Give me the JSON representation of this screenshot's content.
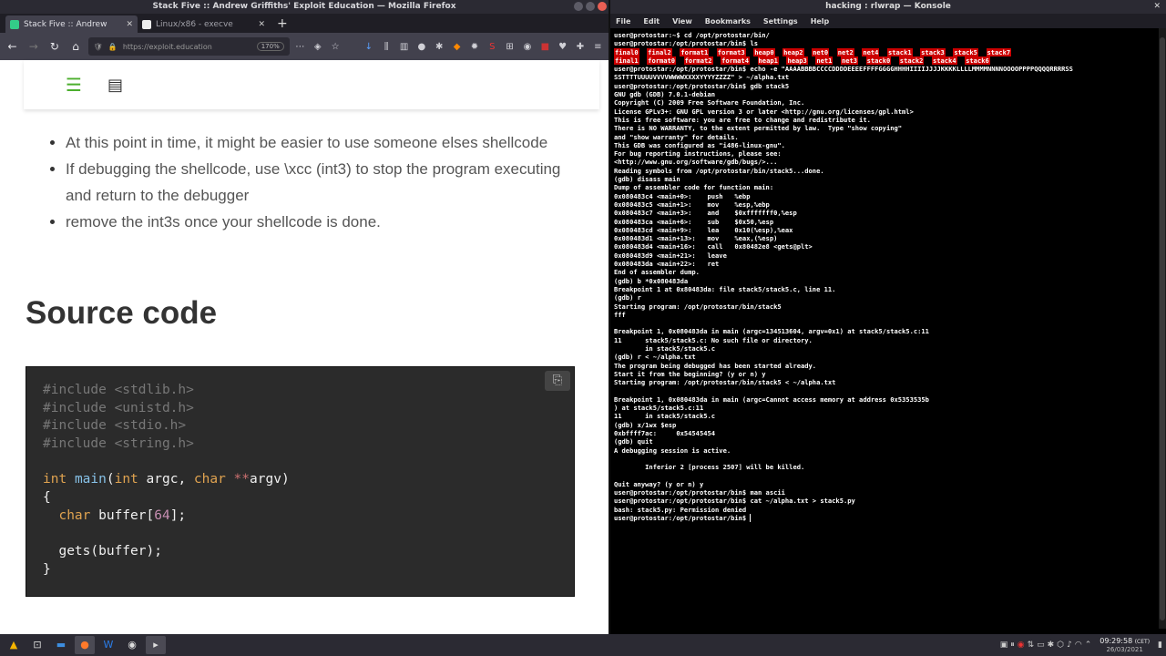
{
  "firefox": {
    "title": "Stack Five :: Andrew Griffiths' Exploit Education — Mozilla Firefox",
    "tabs": [
      {
        "label": "Stack Five :: Andrew"
      },
      {
        "label": "Linux/x86 - execve"
      }
    ],
    "url_placeholder": "https://exploit.education",
    "zoom": "170%",
    "bullets": [
      "At this point in time, it might be easier to use someone elses shellcode",
      "If debugging the shellcode, use \\xcc (int3) to stop the program executing and return to the debugger",
      "remove the int3s once your shellcode is done."
    ],
    "heading": "Source code",
    "code": {
      "includes": [
        "#include <stdlib.h>",
        "#include <unistd.h>",
        "#include <stdio.h>",
        "#include <string.h>"
      ],
      "main_kw": "int",
      "main_fn": "main",
      "main_args_1": "(",
      "main_int": "int",
      "main_argc": " argc, ",
      "main_char": "char",
      "main_star": " **",
      "main_argv": "argv)",
      "open_brace": "{",
      "buf_kw": "char",
      "buf_decl_1": " buffer[",
      "buf_size": "64",
      "buf_decl_2": "];",
      "gets_line": "gets(buffer);",
      "close_brace": "}"
    }
  },
  "konsole": {
    "title": "hacking : rlwrap — Konsole",
    "menu": [
      "File",
      "Edit",
      "View",
      "Bookmarks",
      "Settings",
      "Help"
    ],
    "ls_items": [
      "final0",
      "final1",
      "final2",
      "format0",
      "format1",
      "format2",
      "format3",
      "format4",
      "heap0",
      "heap1",
      "heap2",
      "heap3",
      "net0",
      "net1",
      "net2",
      "net3",
      "net4",
      "stack0",
      "stack1",
      "stack2",
      "stack3",
      "stack4",
      "stack5",
      "stack6",
      "stack7"
    ],
    "lines": [
      "user@protostar:~$ cd /opt/protostar/bin/",
      "user@protostar:/opt/protostar/bin$ ls",
      "user@protostar:/opt/protostar/bin$ echo -e \"AAAABBBBCCCCDDDDEEEEFFFFGGGGHHHHIIIIJJJJKKKKLLLLMMMMNNNNOOOOPPPPQQQQRRRRSSSSTTTTUUUUVVVVWWWWXXXXYYYYZZZZ\" > ~/alpha.txt",
      "user@protostar:/opt/protostar/bin$ gdb stack5",
      "GNU gdb (GDB) 7.0.1-debian",
      "Copyright (C) 2009 Free Software Foundation, Inc.",
      "License GPLv3+: GNU GPL version 3 or later <http://gnu.org/licenses/gpl.html>",
      "This is free software: you are free to change and redistribute it.",
      "There is NO WARRANTY, to the extent permitted by law.  Type \"show copying\"",
      "and \"show warranty\" for details.",
      "This GDB was configured as \"i486-linux-gnu\".",
      "For bug reporting instructions, please see:",
      "<http://www.gnu.org/software/gdb/bugs/>...",
      "Reading symbols from /opt/protostar/bin/stack5...done.",
      "(gdb) disass main",
      "Dump of assembler code for function main:",
      "0x080483c4 <main+0>:    push   %ebp",
      "0x080483c5 <main+1>:    mov    %esp,%ebp",
      "0x080483c7 <main+3>:    and    $0xfffffff0,%esp",
      "0x080483ca <main+6>:    sub    $0x50,%esp",
      "0x080483cd <main+9>:    lea    0x10(%esp),%eax",
      "0x080483d1 <main+13>:   mov    %eax,(%esp)",
      "0x080483d4 <main+16>:   call   0x80482e8 <gets@plt>",
      "0x080483d9 <main+21>:   leave",
      "0x080483da <main+22>:   ret",
      "End of assembler dump.",
      "(gdb) b *0x080483da",
      "Breakpoint 1 at 0x80483da: file stack5/stack5.c, line 11.",
      "(gdb) r",
      "Starting program: /opt/protostar/bin/stack5",
      "fff",
      "",
      "Breakpoint 1, 0x080483da in main (argc=134513604, argv=0x1) at stack5/stack5.c:11",
      "11      stack5/stack5.c: No such file or directory.",
      "        in stack5/stack5.c",
      "(gdb) r < ~/alpha.txt",
      "The program being debugged has been started already.",
      "Start it from the beginning? (y or n) y",
      "Starting program: /opt/protostar/bin/stack5 < ~/alpha.txt",
      "",
      "Breakpoint 1, 0x080483da in main (argc=Cannot access memory at address 0x5353535b",
      ") at stack5/stack5.c:11",
      "11      in stack5/stack5.c",
      "(gdb) x/1wx $esp",
      "0xbffff7ac:     0x54545454",
      "(gdb) quit",
      "A debugging session is active.",
      "",
      "        Inferior 2 [process 2507] will be killed.",
      "",
      "Quit anyway? (y or n) y",
      "user@protostar:/opt/protostar/bin$ man ascii",
      "user@protostar:/opt/protostar/bin$ cat ~/alpha.txt > stack5.py",
      "bash: stack5.py: Permission denied",
      "user@protostar:/opt/protostar/bin$ "
    ]
  },
  "taskbar": {
    "time": "09:29:58",
    "tz": "(CET)",
    "date": "26/03/2021"
  }
}
